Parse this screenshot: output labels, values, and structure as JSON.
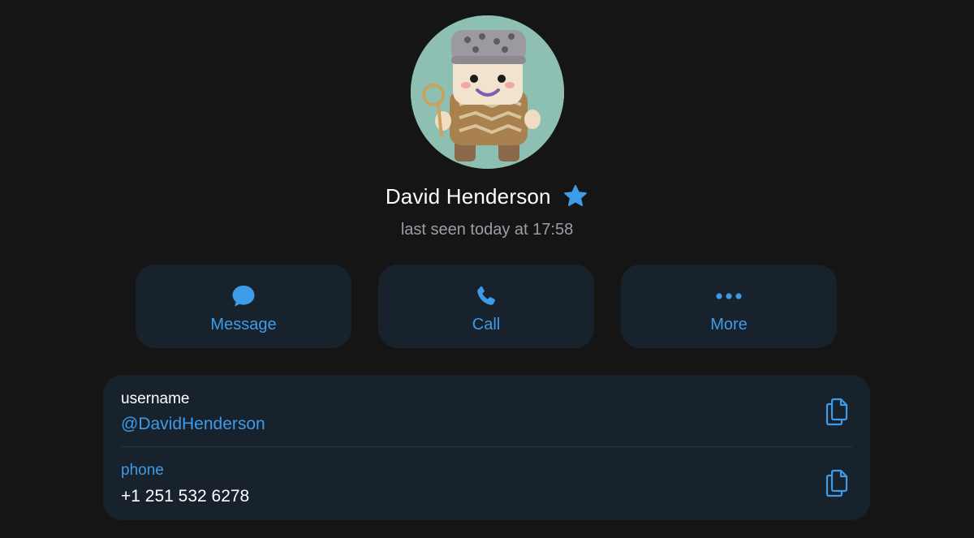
{
  "profile": {
    "name": "David Henderson",
    "status": "last seen today at 17:58",
    "avatar": "knitted-doll-avatar",
    "badge_icon": "star-icon"
  },
  "actions": [
    {
      "label": "Message",
      "icon": "chat-bubble-icon"
    },
    {
      "label": "Call",
      "icon": "phone-icon"
    },
    {
      "label": "More",
      "icon": "more-dots-icon"
    }
  ],
  "info": {
    "username": {
      "label": "username",
      "value": "@DavidHenderson",
      "icon": "copy-icon"
    },
    "phone": {
      "label": "phone",
      "value": "+1 251 532 6278",
      "icon": "copy-icon"
    }
  },
  "colors": {
    "background": "#151515",
    "card": "#18222d",
    "accent": "#3d9be8",
    "secondary_text": "#9a9ea6"
  }
}
